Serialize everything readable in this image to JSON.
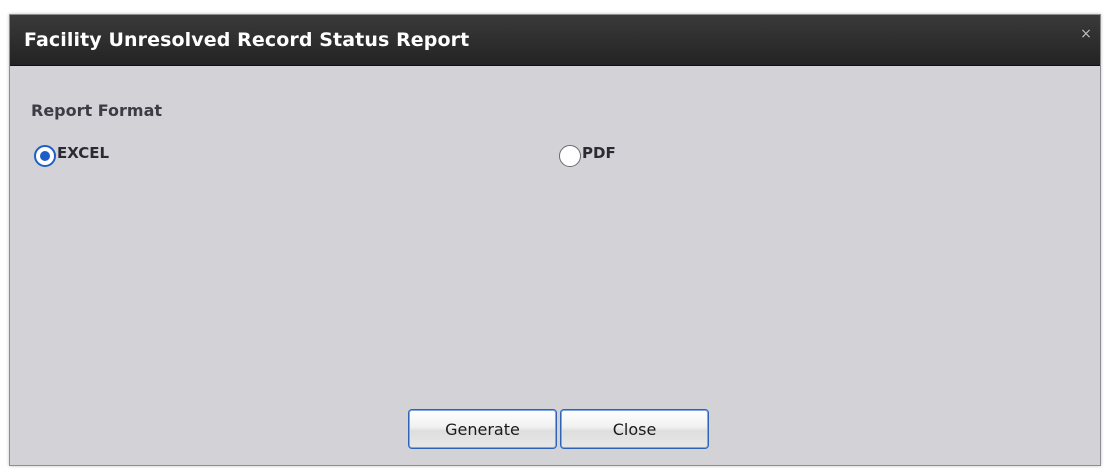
{
  "dialog": {
    "title": "Facility Unresolved Record Status Report",
    "close_glyph": "×"
  },
  "report_format": {
    "label": "Report Format",
    "options": [
      {
        "label": "EXCEL",
        "selected": true
      },
      {
        "label": "PDF",
        "selected": false
      }
    ]
  },
  "buttons": {
    "generate_label": "Generate",
    "close_label": "Close"
  },
  "colors": {
    "accent": "#1f5ec9",
    "titlebar": "#2b2b2b",
    "dialog_bg": "#d3d3d7"
  },
  "icons": {
    "close": "close-icon",
    "radio_checked": "radio-checked-icon",
    "radio_unchecked": "radio-unchecked-icon"
  }
}
